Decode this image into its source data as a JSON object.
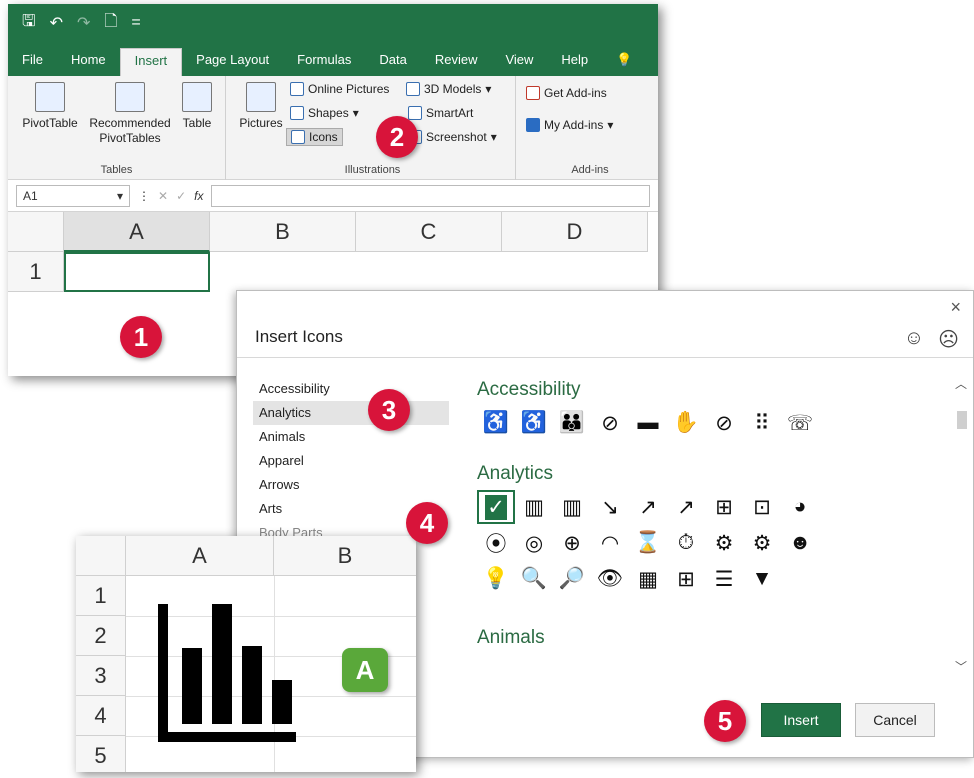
{
  "excel": {
    "menu_tabs": [
      "File",
      "Home",
      "Insert",
      "Page Layout",
      "Formulas",
      "Data",
      "Review",
      "View",
      "Help"
    ],
    "active_tab": "Insert",
    "groups": {
      "tables": {
        "label": "Tables",
        "pivot": "PivotTable",
        "recommended_1": "Recommended",
        "recommended_2": "PivotTables",
        "table": "Table"
      },
      "illustrations": {
        "label": "Illustrations",
        "pictures": "Pictures",
        "online_pictures": "Online Pictures",
        "shapes": "Shapes",
        "icons": "Icons",
        "models": "3D Models",
        "smartart": "SmartArt",
        "screenshot": "Screenshot"
      },
      "addins": {
        "label": "Add-ins",
        "get": "Get Add-ins",
        "my": "My Add-ins"
      }
    },
    "namebox": "A1",
    "fx": "fx",
    "columns": [
      "A",
      "B",
      "C",
      "D"
    ],
    "rows": [
      "1"
    ]
  },
  "dialog": {
    "title": "Insert Icons",
    "close": "×",
    "smile": "☺",
    "frown": "☹",
    "categories": [
      "Accessibility",
      "Analytics",
      "Animals",
      "Apparel",
      "Arrows",
      "Arts",
      "Body Parts"
    ],
    "selected_category": "Analytics",
    "sections": {
      "accessibility": "Accessibility",
      "analytics": "Analytics",
      "animals": "Animals"
    },
    "insert_label": "Insert",
    "cancel_label": "Cancel"
  },
  "sheet2": {
    "columns": [
      "A",
      "B"
    ],
    "rows": [
      "1",
      "2",
      "3",
      "4",
      "5"
    ]
  },
  "callouts": {
    "one": "1",
    "two": "2",
    "three": "3",
    "four": "4",
    "five": "5",
    "a": "A"
  },
  "colors": {
    "excel_green": "#217346",
    "callout_red": "#d8143a",
    "callout_green": "#5aa83a"
  }
}
